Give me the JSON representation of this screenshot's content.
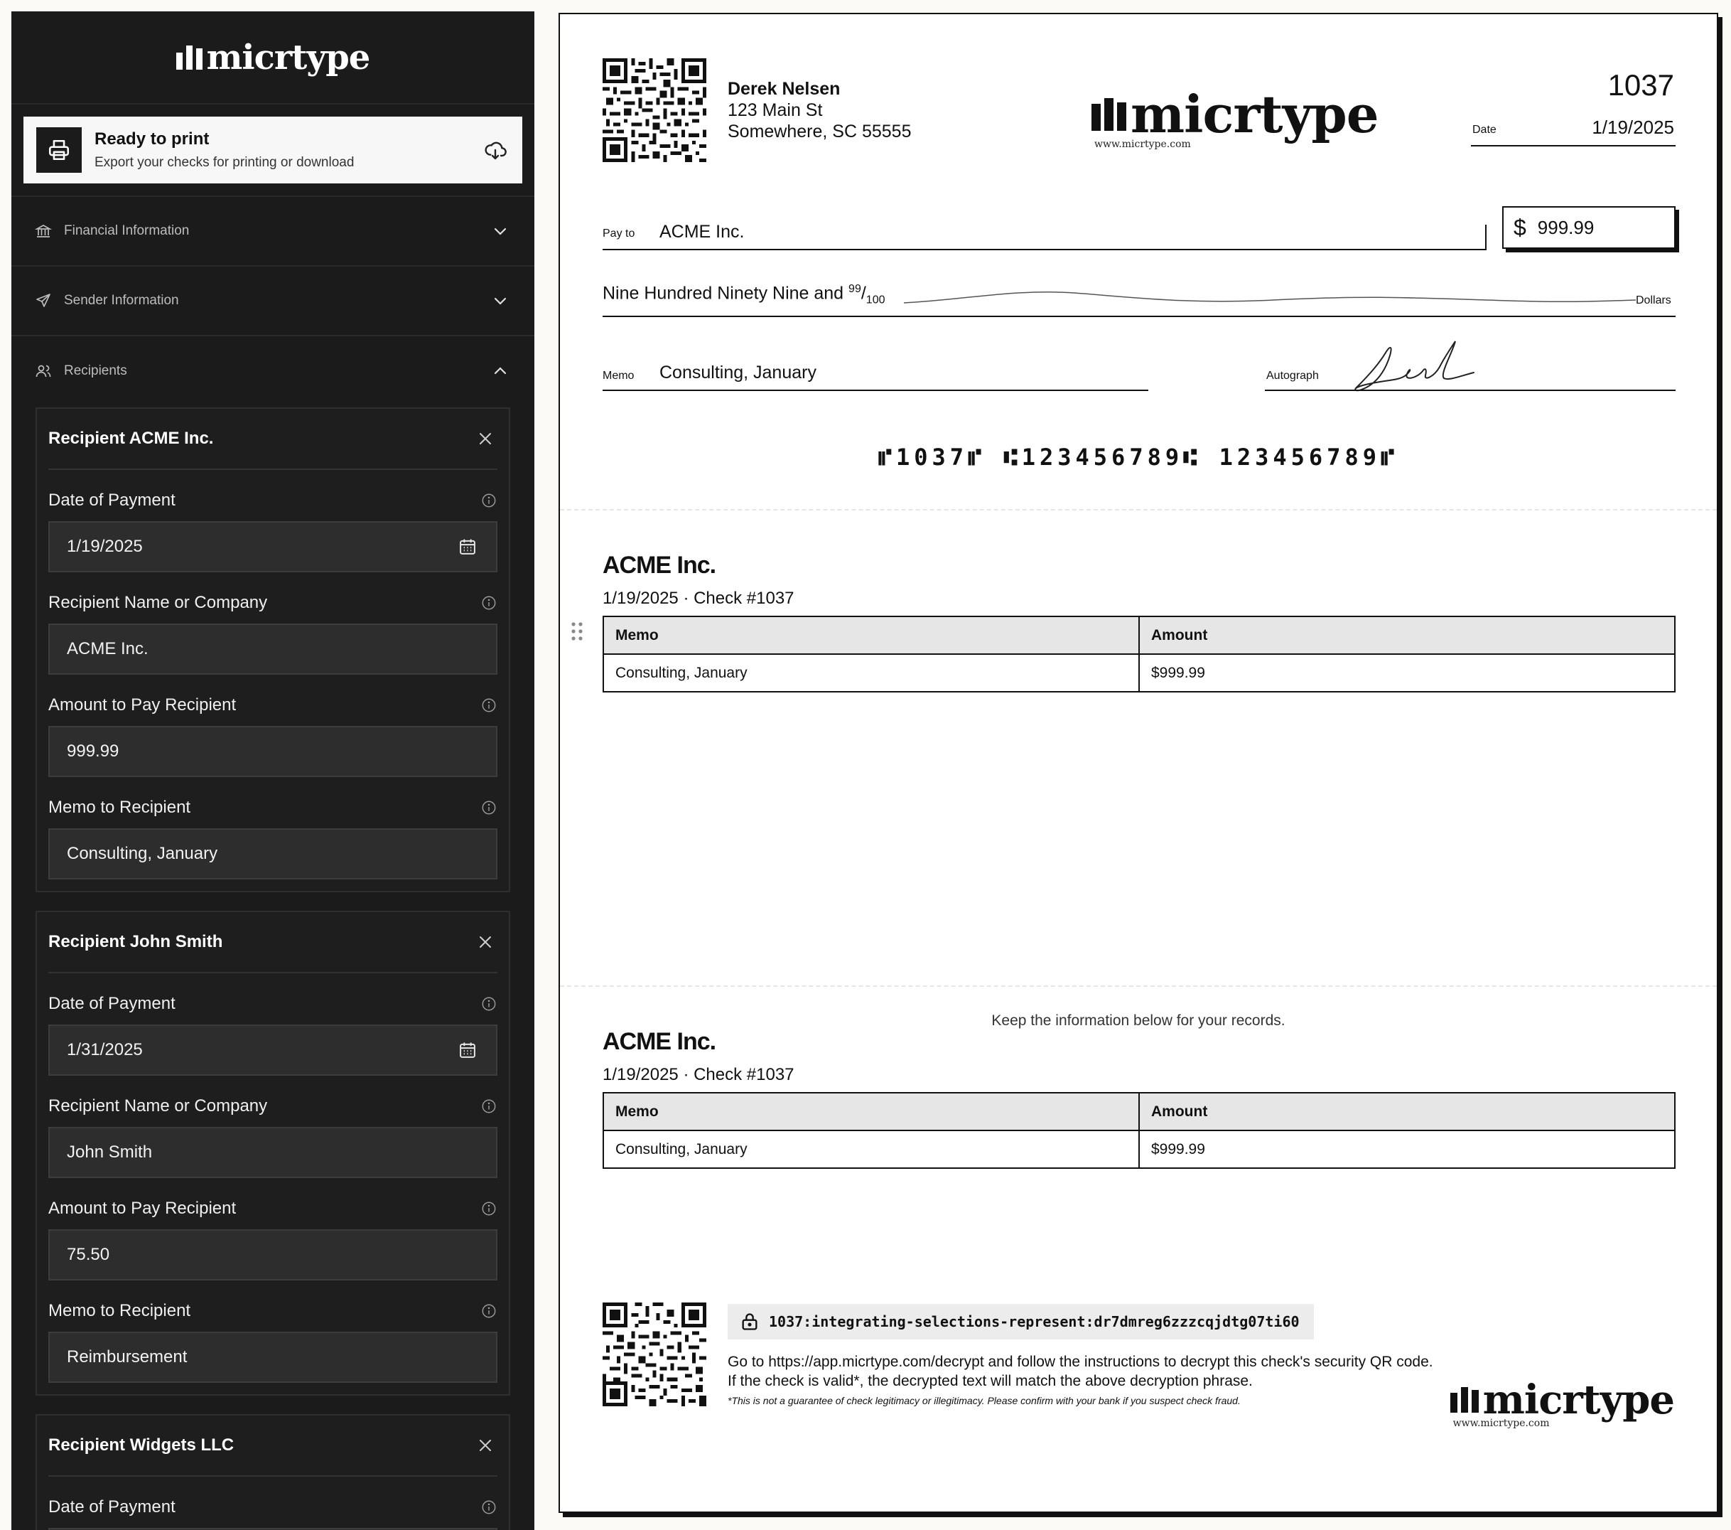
{
  "sidebar": {
    "logo": "micrtype",
    "ready": {
      "title": "Ready to print",
      "subtitle": "Export your checks for printing or download"
    },
    "sections": {
      "financial": "Financial Information",
      "sender": "Sender Information",
      "recipients": "Recipients"
    },
    "recipients": [
      {
        "title": "Recipient ACME Inc.",
        "date_label": "Date of Payment",
        "date_value": "1/19/2025",
        "name_label": "Recipient Name or Company",
        "name_value": "ACME Inc.",
        "amount_label": "Amount to Pay Recipient",
        "amount_value": "999.99",
        "memo_label": "Memo to Recipient",
        "memo_value": "Consulting, January"
      },
      {
        "title": "Recipient John Smith",
        "date_label": "Date of Payment",
        "date_value": "1/31/2025",
        "name_label": "Recipient Name or Company",
        "name_value": "John Smith",
        "amount_label": "Amount to Pay Recipient",
        "amount_value": "75.50",
        "memo_label": "Memo to Recipient",
        "memo_value": "Reimbursement"
      },
      {
        "title": "Recipient Widgets LLC",
        "date_label": "Date of Payment"
      }
    ]
  },
  "check": {
    "sender_name": "Derek Nelsen",
    "sender_address1": "123 Main St",
    "sender_address2": "Somewhere, SC 55555",
    "logo": "micrtype",
    "logo_url": "www.micrtype.com",
    "number": "1037",
    "date_label": "Date",
    "date": "1/19/2025",
    "payto_label": "Pay to",
    "payee": "ACME Inc.",
    "currency_symbol": "$",
    "amount": "999.99",
    "amount_words": "Nine Hundred Ninety Nine and",
    "cents_num": "99",
    "cents_den": "100",
    "dollars_label": "Dollars",
    "memo_label": "Memo",
    "memo": "Consulting, January",
    "autograph_label": "Autograph",
    "micr_line": "⑈1037⑈ ⑆123456789⑆ 123456789⑈"
  },
  "stubs": [
    {
      "title": "ACME Inc.",
      "subtitle": "1/19/2025 · Check #1037",
      "headers": [
        "Memo",
        "Amount"
      ],
      "rows": [
        [
          "Consulting, January",
          "$999.99"
        ]
      ]
    },
    {
      "title": "ACME Inc.",
      "subtitle": "1/19/2025 · Check #1037",
      "headers": [
        "Memo",
        "Amount"
      ],
      "rows": [
        [
          "Consulting, January",
          "$999.99"
        ]
      ]
    }
  ],
  "records_note": "Keep the information below for your records.",
  "security": {
    "phrase": "1037:integrating-selections-represent:dr7dmreg6zzzcqjdtg07ti60",
    "instructions": "Go to https://app.micrtype.com/decrypt and follow the instructions to decrypt this check's security QR code. If the check is valid*, the decrypted text will match the above decryption phrase.",
    "disclaimer": "*This is not a guarantee of check legitimacy or illegitimacy. Please confirm with your bank if you suspect check fraud.",
    "logo": "micrtype",
    "logo_url": "www.micrtype.com"
  },
  "icons": {
    "ready": "printer-icon",
    "download": "cloud-download-icon",
    "financial": "bank-icon",
    "sender": "send-icon",
    "recipients": "users-icon",
    "close": "close-icon",
    "info": "info-icon",
    "calendar": "calendar-icon",
    "lock": "lock-icon",
    "qr": "qr-code-icon"
  },
  "colors": {
    "sidebar_bg": "#1b1b1b",
    "input_bg": "#2d2d2d",
    "paper": "#ffffff",
    "page_bg": "#fbf9f5",
    "table_header": "#e6e6e6"
  }
}
